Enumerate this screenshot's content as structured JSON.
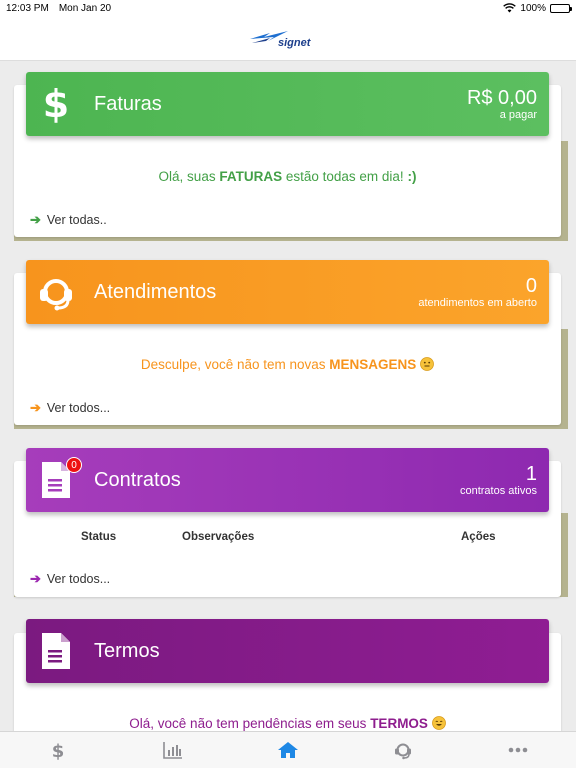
{
  "status_bar": {
    "time": "12:03 PM",
    "date": "Mon Jan 20",
    "battery": "100%"
  },
  "header": {
    "logo_text": "signet"
  },
  "colors": {
    "faturas": "#4caf50",
    "atendimentos": "#f7941d",
    "contratos": "#9c27b0",
    "termos": "#8e1d8e"
  },
  "faturas": {
    "title": "Faturas",
    "amount": "R$ 0,00",
    "amount_caption": "a pagar",
    "message_pre": "Olá, suas",
    "message_bold": "FATURAS",
    "message_post": "estão todas em dia!",
    "message_smile": ":)",
    "link": "Ver todas.."
  },
  "atendimentos": {
    "title": "Atendimentos",
    "count": "0",
    "count_caption": "atendimentos em aberto",
    "message_pre": "Desculpe, você não tem novas",
    "message_bold": "MENSAGENS",
    "link": "Ver todos..."
  },
  "contratos": {
    "title": "Contratos",
    "badge": "0",
    "count": "1",
    "count_caption": "contratos ativos",
    "columns": [
      "Status",
      "Observações",
      "Ações"
    ],
    "link": "Ver todos..."
  },
  "termos": {
    "title": "Termos",
    "message_pre": "Olá, você não tem pendências em seus",
    "message_bold": "TERMOS"
  },
  "tabbar": {
    "tabs": [
      {
        "icon": "dollar-icon",
        "active": false
      },
      {
        "icon": "bar-chart-icon",
        "active": false
      },
      {
        "icon": "home-icon",
        "active": true
      },
      {
        "icon": "headset-icon",
        "active": false
      },
      {
        "icon": "more-icon",
        "active": false
      }
    ]
  }
}
